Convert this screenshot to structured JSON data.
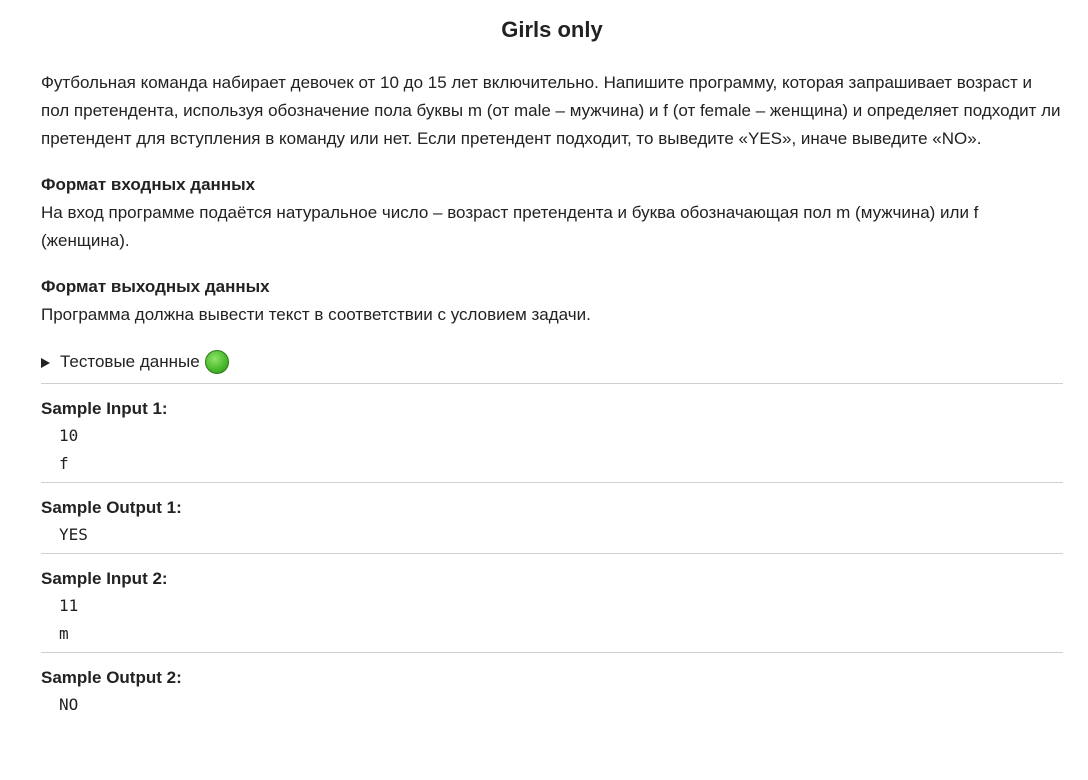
{
  "problem": {
    "title": "Girls only",
    "statement": "Футбольная команда набирает девочек от 10 до 15 лет включительно. Напишите программу, которая запрашивает возраст и пол претендента, используя обозначение пола буквы m (от male – мужчина) и f (от female – женщина) и определяет подходит ли претендент для вступления в команду или нет. Если претендент подходит, то выведите «YES», иначе выведите «NO».",
    "input_format": {
      "heading": "Формат входных данных",
      "text": "На вход программе подаётся натуральное число – возраст претендента и буква обозначающая пол m (мужчина) или f (женщина)."
    },
    "output_format": {
      "heading": "Формат выходных данных",
      "text": "Программа должна вывести текст в соответствии с условием задачи."
    },
    "tests_toggle": {
      "label": "Тестовые данные",
      "status_color": "#4cbb2f"
    },
    "samples": [
      {
        "label": "Sample Input 1:",
        "lines": [
          "10",
          "f"
        ]
      },
      {
        "label": "Sample Output 1:",
        "lines": [
          "YES"
        ]
      },
      {
        "label": "Sample Input 2:",
        "lines": [
          "11",
          "m"
        ]
      },
      {
        "label": "Sample Output 2:",
        "lines": [
          "NO"
        ]
      }
    ]
  }
}
